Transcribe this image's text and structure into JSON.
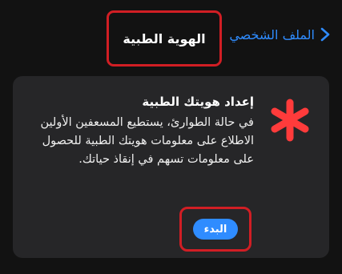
{
  "nav": {
    "back_label": "الملف الشخصي",
    "back_icon": "chevron-right-icon",
    "title": "الهوية الطبية"
  },
  "card": {
    "title": "إعداد هويتك الطبية",
    "body": "في حالة الطوارئ، يستطيع المسعفين الأولين الاطلاع على معلومات هويتك الطبية للحصول على معلومات تسهم في إنقاذ حياتك.",
    "icon": "medical-asterisk-icon",
    "start_button": "البدء"
  },
  "colors": {
    "background": "#121212",
    "card": "#262628",
    "accent": "#2f8cff",
    "asterisk": "#ff3b3b",
    "highlight": "#d11e24"
  }
}
